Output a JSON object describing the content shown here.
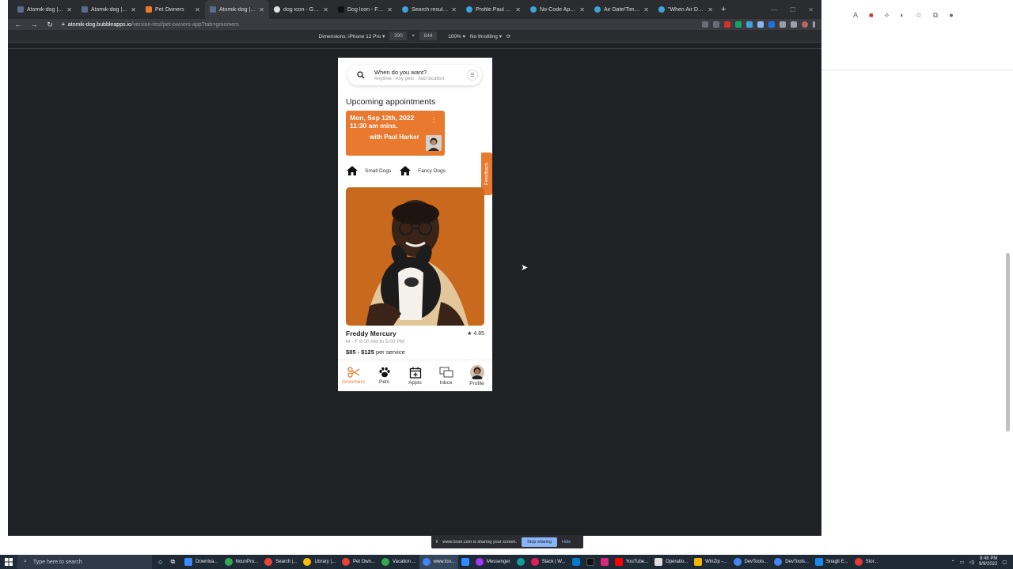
{
  "browser": {
    "tabs": [
      {
        "title": "Atomik-dog | Bubble"
      },
      {
        "title": "Atomik-dog | Bubble"
      },
      {
        "title": "Pet Owners"
      },
      {
        "title": "Atomik-dog | Bubble"
      },
      {
        "title": "dog icon - Google"
      },
      {
        "title": "Dog Icon - Free H"
      },
      {
        "title": "Search results for"
      },
      {
        "title": "Profile Paul Harker"
      },
      {
        "title": "No-Code App Plu"
      },
      {
        "title": "Air Date/Time Pic"
      },
      {
        "title": "\"When Air Date/Ti"
      }
    ],
    "url_host": "atomik-dog.bubbleapps.io",
    "url_path": "/version-test/pet-owners-app?tab=groomers"
  },
  "devtools": {
    "dimensions_label": "Dimensions: iPhone 12 Pro ▾",
    "width": "390",
    "times": "×",
    "height": "844",
    "zoom": "100% ▾",
    "throttle": "No throttling ▾"
  },
  "app": {
    "search": {
      "question": "When do you want?",
      "subtitle": "Anytime · Any pets · Add location"
    },
    "upcoming_title": "Upcoming appointments",
    "appointment": {
      "date_line": "Mon, Sep 12th, 2022",
      "time_line": "11:30 am  mins.",
      "with_line": "with Paul Harker",
      "menu_glyph": "⋮"
    },
    "feedback_label": "Feedback",
    "categories": [
      {
        "label": "Small Dogs"
      },
      {
        "label": "Fancy Dogs"
      }
    ],
    "groomer": {
      "name": "Freddy Mercury",
      "rating": "4.85",
      "hours": "M - F 8:00 AM to 5:00 PM",
      "price_bold": "$85 - $125",
      "price_suffix": " per service"
    },
    "nav": [
      {
        "label": "Groomers",
        "icon": "scissors-icon",
        "active": true
      },
      {
        "label": "Pets",
        "icon": "paw-icon",
        "active": false
      },
      {
        "label": "Appts",
        "icon": "calendar-plus-icon",
        "active": false
      },
      {
        "label": "Inbox",
        "icon": "chat-icon",
        "active": false
      },
      {
        "label": "Profile",
        "icon": "avatar",
        "active": false
      }
    ],
    "accent_color": "#e8792f"
  },
  "share_bar": {
    "message": "www.loom.com is sharing your screen.",
    "stop_label": "Stop sharing",
    "hide_label": "Hide"
  },
  "taskbar": {
    "search_placeholder": "Type here to search",
    "apps": [
      {
        "label": "Downloa..."
      },
      {
        "label": "NounPro..."
      },
      {
        "label": "Search |..."
      },
      {
        "label": "Library |..."
      },
      {
        "label": "Pet Own..."
      },
      {
        "label": "Vacation ..."
      },
      {
        "label": "www.loo..."
      },
      {
        "label": "Messenger"
      },
      {
        "label": "Slack | W..."
      },
      {
        "label": "YouTube..."
      },
      {
        "label": "Operatio..."
      },
      {
        "label": "WinZip -..."
      },
      {
        "label": "DevTools..."
      },
      {
        "label": "DevTools..."
      },
      {
        "label": "Snagit E..."
      },
      {
        "label": "Stor..."
      }
    ],
    "time": "8:48 PM",
    "date": "9/9/2022"
  }
}
